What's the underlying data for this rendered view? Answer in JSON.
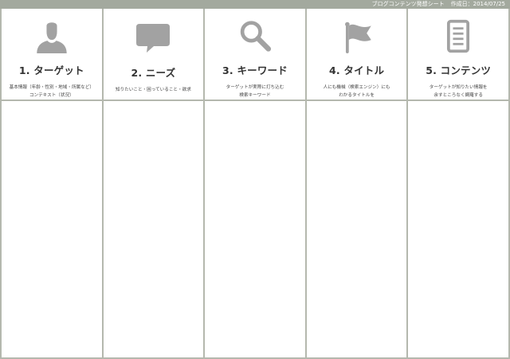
{
  "header": {
    "sheet_title": "ブログコンテンツ発想シート",
    "created_label": "作成日：",
    "created_date": "2014/07/25"
  },
  "columns": [
    {
      "number": "1.",
      "title": "ターゲット",
      "icon": "person-icon",
      "desc_line1": "基本情報（年齢・性別・地域・所属など）",
      "desc_line2": "コンテキスト（状況）"
    },
    {
      "number": "2.",
      "title": "ニーズ",
      "icon": "speech-bubble-icon",
      "desc_line1": "知りたいこと・困っていること・欲求",
      "desc_line2": ""
    },
    {
      "number": "3.",
      "title": "キーワード",
      "icon": "search-icon",
      "desc_line1": "ターゲットが実際に打ち込む",
      "desc_line2": "検索キーワード"
    },
    {
      "number": "4.",
      "title": "タイトル",
      "icon": "flag-icon",
      "desc_line1": "人にも機械（検索エンジン）にも",
      "desc_line2": "わかるタイトルを"
    },
    {
      "number": "5.",
      "title": "コンテンツ",
      "icon": "document-icon",
      "desc_line1": "ターゲットが知りたい情報を",
      "desc_line2": "余すところなく網羅する"
    }
  ],
  "colors": {
    "bar": "#a3a99e",
    "border": "#b4b8ae",
    "icon": "#a2a2a2"
  }
}
